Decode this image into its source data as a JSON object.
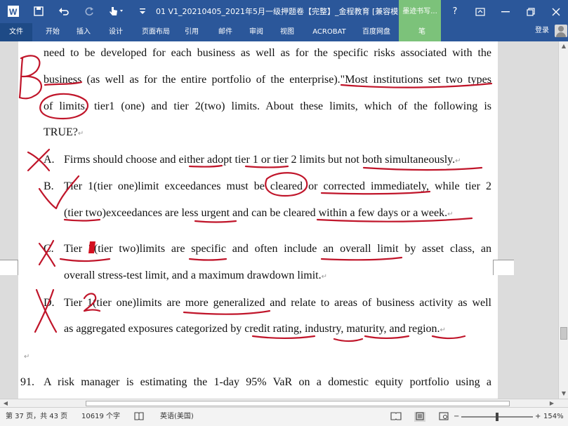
{
  "titlebar": {
    "title": "01 V1_20210405_2021年5月一级押题卷【完整】_金程教育 [兼容模式] - Mic...",
    "pen_tab": "墨迹书写..."
  },
  "ribbon": {
    "tabs": [
      "文件",
      "开始",
      "插入",
      "设计",
      "页面布局",
      "引用",
      "邮件",
      "审阅",
      "视图",
      "ACROBAT",
      "百度网盘",
      "笔"
    ],
    "login": "登录"
  },
  "document": {
    "lines": [
      "need to be developed for each business as well as for the specific risks associated with the",
      "business (as well as for the entire portfolio of the enterprise).\"Most institutions set two types",
      "of limits, tier1 (one) and tier 2(two) limits. About these limits, which of the following is",
      "TRUE?"
    ],
    "options": [
      {
        "letter": "A.",
        "lines": [
          "Firms should choose and either adopt tier 1 or tier 2 limits but not both simultaneously."
        ]
      },
      {
        "letter": "B.",
        "lines": [
          "Tier 1(tier one)limit exceedances must be cleared or corrected immediately, while tier 2",
          "(tier two)exceedances are less urgent and can be cleared within a few days or a week."
        ]
      },
      {
        "letter": "C.",
        "lines": [
          "Tier 2(tier two)limits are specific and often include an overall limit by asset class, an",
          "overall stress-test limit, and a maximum drawdown limit."
        ]
      },
      {
        "letter": "D.",
        "lines": [
          "Tier 1(tier one)limits are more generalized and relate to areas of business activity as well",
          "as aggregated exposures categorized by credit rating, industry, maturity, and region."
        ]
      }
    ],
    "next_question": {
      "number": "91.",
      "text": "A risk manager is estimating the 1-day 95% VaR on a domestic equity portfolio using a"
    }
  },
  "status": {
    "page": "第 37 页，共 43 页",
    "words": "10619 个字",
    "language": "英语(美国)",
    "zoom": "154%",
    "zoom_level": 0.5
  },
  "colors": {
    "title_bar": "#2b579a",
    "pen_tab": "#7cc27a",
    "ink": "#c0152a"
  }
}
